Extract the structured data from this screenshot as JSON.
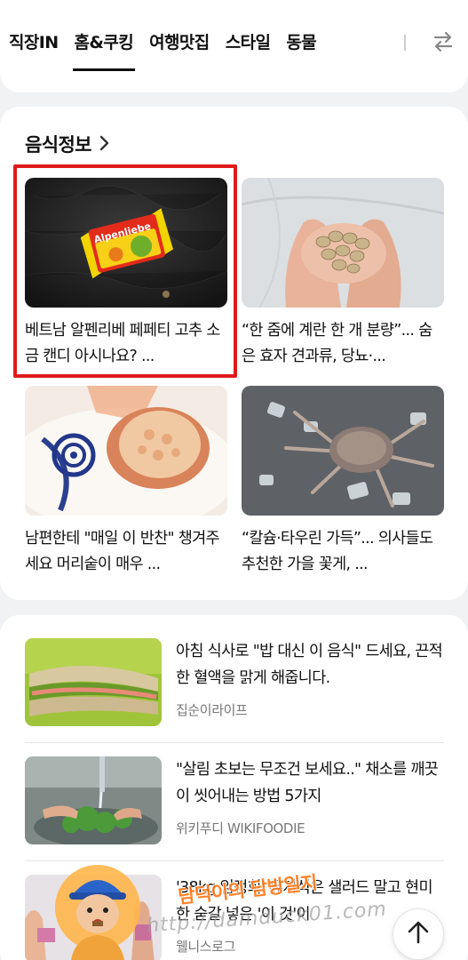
{
  "tabs": [
    {
      "label": "직장IN",
      "active": false
    },
    {
      "label": "홈&쿠킹",
      "active": true
    },
    {
      "label": "여행맛집",
      "active": false
    },
    {
      "label": "스타일",
      "active": false
    },
    {
      "label": "동물",
      "active": false
    }
  ],
  "food_section": {
    "title": "음식정보",
    "items": [
      {
        "caption": "베트남 알펜리베 페페티 고추 소금 캔디 아시나요? ...",
        "candy_wrapper_text": "Alpenliebe",
        "highlighted": true
      },
      {
        "caption": "“한 줌에 계란 한 개 분량”... 숨은 효자 견과류, 당뇨·...",
        "highlighted": false
      },
      {
        "caption": "남편한테 \"매일 이 반찬\" 챙겨주세요 머리숱이 매우 ...",
        "highlighted": false
      },
      {
        "caption": "“칼슘·타우린 가득”... 의사들도 추천한 가을 꽃게, ...",
        "highlighted": false
      }
    ]
  },
  "article_list": [
    {
      "title": "아침 식사로 \"밥 대신 이 음식\" 드세요, 끈적한 혈액을 맑게 해줍니다.",
      "source": "집순이라이프"
    },
    {
      "title": "\"살림 초보는 무조건 보세요..\" 채소를 깨끗이 씻어내는 방법 5가지",
      "source": "위키푸디 WIKIFOODIE"
    },
    {
      "title": "'38kg 임정희' 유지식은 샐러드 말고 현미 한 숟갈 넣은 '이 것'이",
      "source": "웰니스로그"
    }
  ],
  "watermark": {
    "caption": "담덕이의 담방일지",
    "url": "http://damduck01.com"
  },
  "colors": {
    "highlight_border": "#e01a1a",
    "watermark_text": "#ff7a1a"
  },
  "icons": {
    "swap": "swap-arrows-icon",
    "chevron": "chevron-right-icon",
    "scroll_top": "arrow-up-icon"
  }
}
